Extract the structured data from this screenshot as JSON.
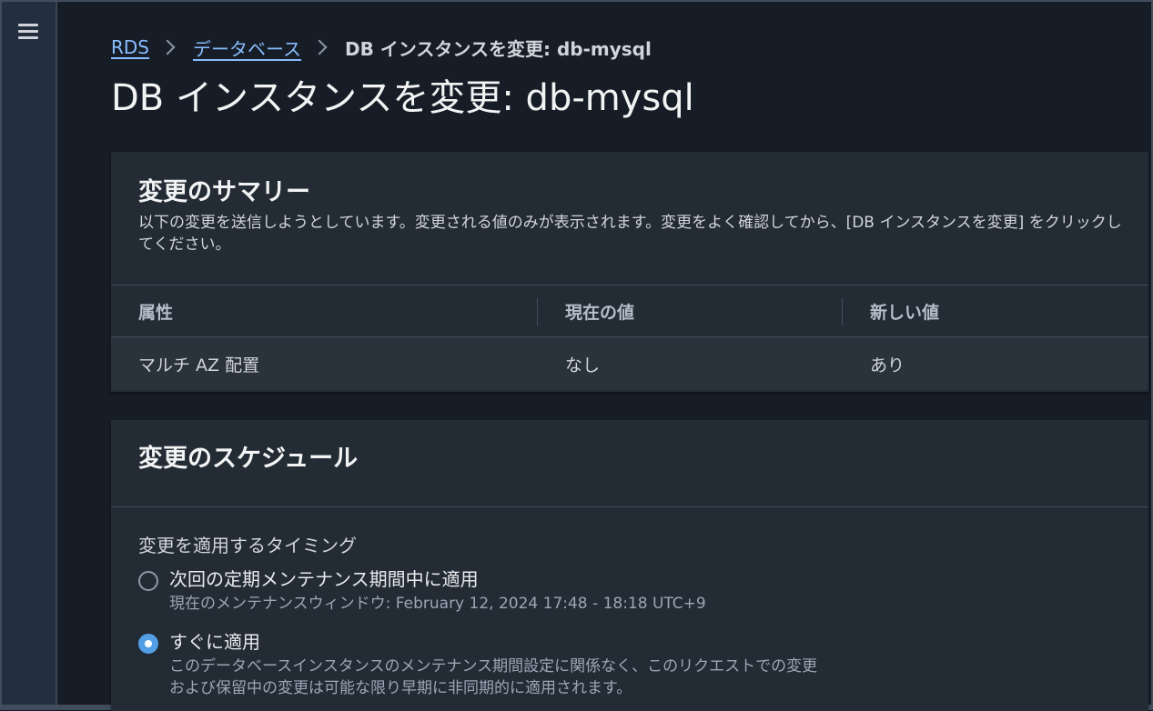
{
  "breadcrumb": {
    "items": [
      "RDS",
      "データベース"
    ],
    "current": "DB インスタンスを変更: db-mysql"
  },
  "page_title": "DB インスタンスを変更: db-mysql",
  "summary": {
    "title": "変更のサマリー",
    "description": "以下の変更を送信しようとしています。変更される値のみが表示されます。変更をよく確認してから、[DB インスタンスを変更] をクリックしてください。",
    "columns": [
      "属性",
      "現在の値",
      "新しい値"
    ],
    "rows": [
      [
        "マルチ AZ 配置",
        "なし",
        "あり"
      ]
    ]
  },
  "schedule": {
    "title": "変更のスケジュール",
    "timing_label": "変更を適用するタイミング",
    "options": [
      {
        "label": "次回の定期メンテナンス期間中に適用",
        "description": "現在のメンテナンスウィンドウ: February 12, 2024 17:48 - 18:18 UTC+9",
        "selected": false
      },
      {
        "label": "すぐに適用",
        "description_line1": "このデータベースインスタンスのメンテナンス期間設定に関係なく、このリクエストでの変更",
        "description_line2": "および保留中の変更は可能な限り早期に非同期的に適用されます。",
        "selected": true
      }
    ]
  },
  "colors": {
    "link": "#89bdff",
    "radio_selected": "#539fe5",
    "background": "#161d26",
    "panel": "#232b35"
  }
}
